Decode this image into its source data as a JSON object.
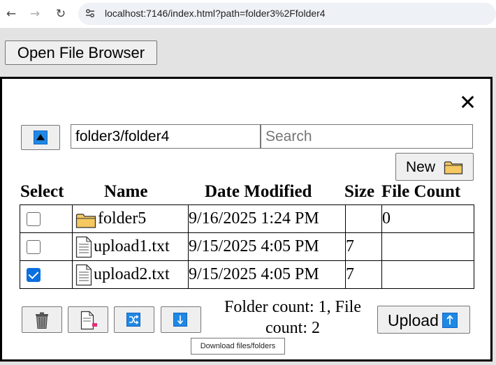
{
  "browser": {
    "url": "localhost:7146/index.html?path=folder3%2Ffolder4",
    "back_icon": "←",
    "forward_icon": "→",
    "reload_icon": "↻"
  },
  "page": {
    "open_button_label": "Open File Browser"
  },
  "dialog": {
    "close_icon": "✕",
    "path_value": "folder3/folder4",
    "search_placeholder": "Search",
    "new_button_label": "New",
    "columns": [
      "Select",
      "Name",
      "Date Modified",
      "Size",
      "File Count"
    ],
    "rows": [
      {
        "checked": false,
        "type": "folder",
        "name": "folder5",
        "date": "9/16/2025 1:24 PM",
        "size": "",
        "file_count": "0"
      },
      {
        "checked": false,
        "type": "file",
        "name": "upload1.txt",
        "date": "9/15/2025 4:05 PM",
        "size": "7",
        "file_count": ""
      },
      {
        "checked": true,
        "type": "file",
        "name": "upload2.txt",
        "date": "9/15/2025 4:05 PM",
        "size": "7",
        "file_count": ""
      }
    ],
    "count_text": "Folder count: 1, File count: 2",
    "upload_button_label": "Upload",
    "tooltip_text": "Download files/folders",
    "icons": [
      "trash-icon",
      "rename-file-icon",
      "move-icon",
      "download-icon",
      "folder-icon",
      "upload-icon",
      "up-arrow-icon"
    ]
  },
  "colors": {
    "accent_blue": "#1e88e5",
    "checkbox_checked": "#0b6fe0",
    "folder_yellow": "#f6c860"
  }
}
